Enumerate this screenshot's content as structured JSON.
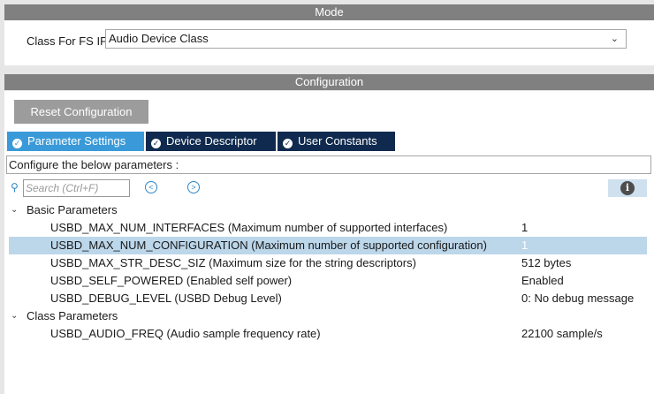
{
  "mode": {
    "header": "Mode",
    "class_label": "Class For FS IP",
    "class_value": "Audio Device Class"
  },
  "configuration": {
    "header": "Configuration",
    "reset_label": "Reset Configuration",
    "tabs": [
      {
        "label": "Parameter Settings",
        "active": true
      },
      {
        "label": "Device Descriptor",
        "active": false
      },
      {
        "label": "User Constants",
        "active": false
      }
    ],
    "description": "Configure the below parameters :",
    "search": {
      "placeholder": "Search (Ctrl+F)",
      "value": ""
    },
    "info_glyph": "i",
    "groups": [
      {
        "label": "Basic Parameters",
        "params": [
          {
            "name": "USBD_MAX_NUM_INTERFACES (Maximum number of supported interfaces)",
            "value": "1"
          },
          {
            "name": "USBD_MAX_NUM_CONFIGURATION (Maximum number of supported configuration)",
            "value": "1",
            "selected": true
          },
          {
            "name": "USBD_MAX_STR_DESC_SIZ (Maximum size for the string descriptors)",
            "value": "512 bytes"
          },
          {
            "name": "USBD_SELF_POWERED (Enabled self power)",
            "value": "Enabled"
          },
          {
            "name": "USBD_DEBUG_LEVEL (USBD Debug Level)",
            "value": "0: No debug message"
          }
        ]
      },
      {
        "label": "Class Parameters",
        "params": [
          {
            "name": "USBD_AUDIO_FREQ (Audio sample frequency rate)",
            "value": "22100 sample/s"
          }
        ]
      }
    ]
  },
  "colors": {
    "header_gray": "#808080",
    "tab_active": "#3a9ad9",
    "tab_inactive": "#0f2a4e",
    "selected_row": "#bcd6ea"
  },
  "icons": {
    "dropdown": "chevron-down-icon",
    "tab_check": "check-circle-icon",
    "search": "search-icon",
    "prev": "arrow-left-circle-icon",
    "next": "arrow-right-circle-icon",
    "info": "info-icon",
    "expand": "chevron-down-icon"
  }
}
